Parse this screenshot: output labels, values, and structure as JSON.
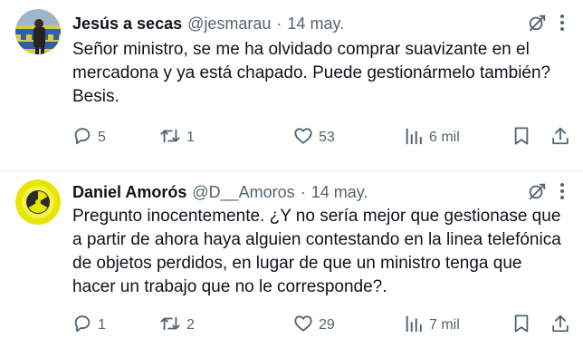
{
  "tweets": [
    {
      "name": "Jesús a secas",
      "handle": "@jesmarau",
      "dot": "·",
      "date": "14 may.",
      "text": "Señor ministro, se me ha olvidado comprar suavizante en el mercadona y ya está chapado. Puede gestionármelo también? Besis.",
      "replies": "5",
      "retweets": "1",
      "likes": "53",
      "views": "6 mil"
    },
    {
      "name": "Daniel Amorós",
      "handle": "@D__Amoros",
      "dot": "·",
      "date": "14 may.",
      "text": "Pregunto inocentemente. ¿Y no sería mejor que gestionase que a partir de ahora haya alguien contestando en la linea telefónica de objetos perdidos, en lugar de que un ministro tenga que hacer un trabajo que no le corresponde?.",
      "replies": "1",
      "retweets": "2",
      "likes": "29",
      "views": "7 mil"
    }
  ],
  "icons": {
    "header": [
      "grok-icon",
      "more-icon"
    ],
    "actions": [
      "reply-icon",
      "retweet-icon",
      "like-icon",
      "views-icon",
      "bookmark-icon",
      "share-icon"
    ]
  },
  "colors": {
    "text": "#0f1419",
    "secondary": "#536471",
    "divider": "#eff3f4",
    "avatar2": "#e6e600"
  }
}
